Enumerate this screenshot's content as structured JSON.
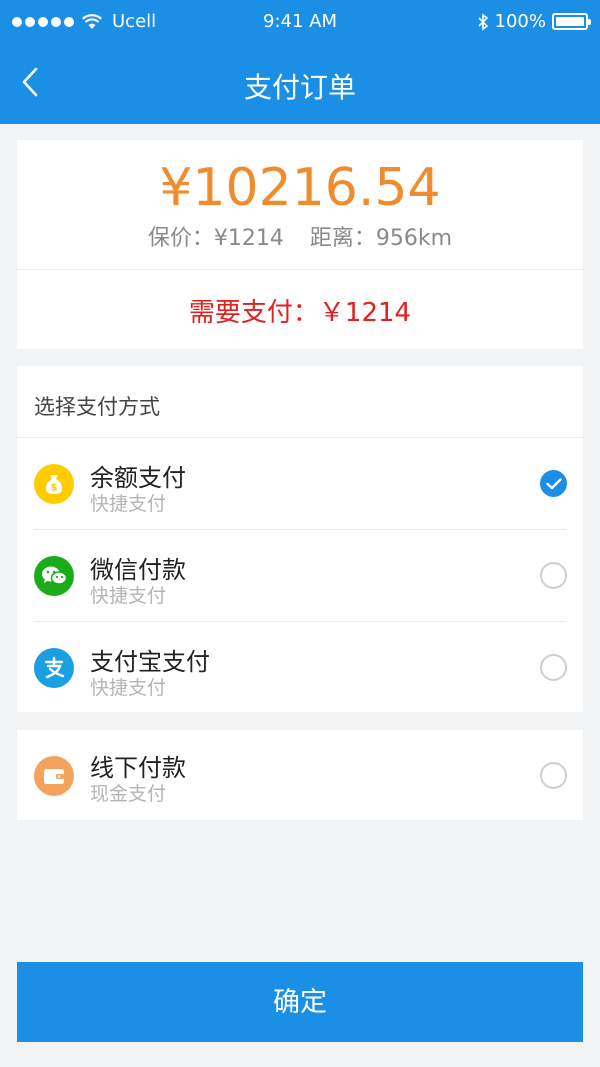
{
  "status_bar": {
    "carrier": "Ucell",
    "time": "9:41 AM",
    "battery": "100%"
  },
  "nav": {
    "title": "支付订单",
    "back_icon": "chevron-left-icon"
  },
  "summary": {
    "amount": "¥10216.54",
    "insured_label": "保价：",
    "insured_value": "¥1214",
    "distance_label": "距离：",
    "distance_value": "956km",
    "need_pay_label": "需要支付：",
    "need_pay_value": "￥1214"
  },
  "methods": {
    "title": "选择支付方式",
    "items": [
      {
        "name": "余额支付",
        "sub": "快捷支付",
        "icon": "money-bag-icon",
        "color": "#ffcc00",
        "selected": true
      },
      {
        "name": "微信付款",
        "sub": "快捷支付",
        "icon": "wechat-icon",
        "color": "#1aad19",
        "selected": false
      },
      {
        "name": "支付宝支付",
        "sub": "快捷支付",
        "icon": "alipay-icon",
        "color": "#1a9fe0",
        "selected": false
      }
    ]
  },
  "offline": {
    "name": "线下付款",
    "sub": "现金支付",
    "icon": "wallet-icon",
    "color": "#f5a35c",
    "selected": false
  },
  "confirm_label": "确定",
  "colors": {
    "primary": "#1b8fe6",
    "amount": "#f08c2e",
    "need_pay": "#e0211f",
    "background": "#f2f3f5"
  }
}
